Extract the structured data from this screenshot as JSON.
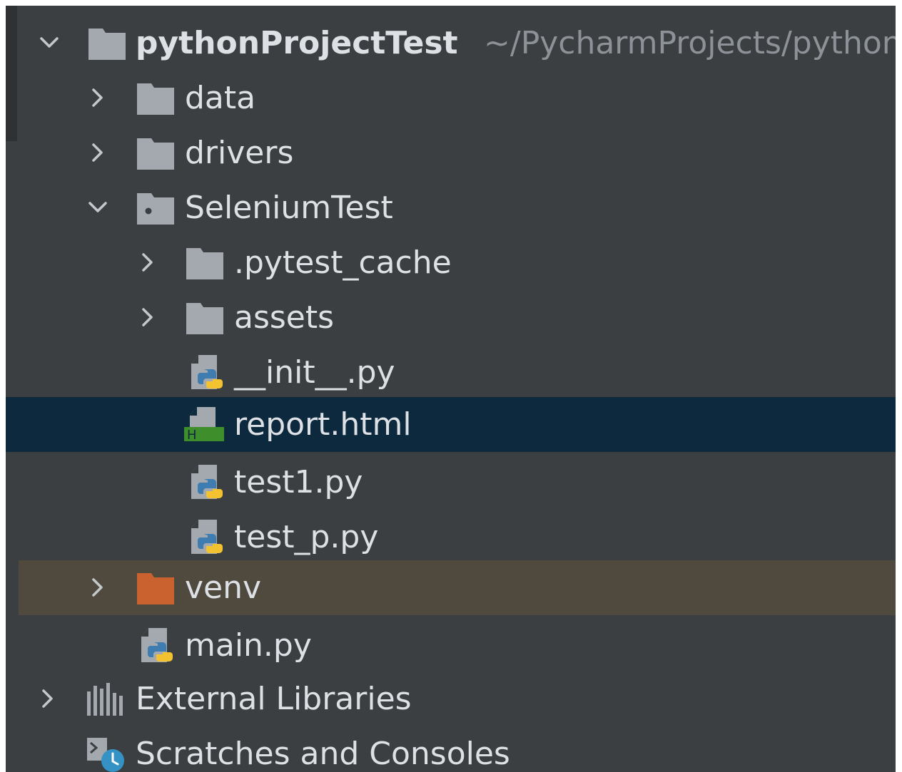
{
  "project_tree": {
    "root": {
      "name": "pythonProjectTest",
      "path": "~/PycharmProjects/pythonProjectTest"
    },
    "items": [
      {
        "name": "data"
      },
      {
        "name": "drivers"
      },
      {
        "name": "SeleniumTest"
      },
      {
        "name": ".pytest_cache"
      },
      {
        "name": "assets"
      },
      {
        "name": "__init__.py"
      },
      {
        "name": "report.html",
        "badge": "H"
      },
      {
        "name": "test1.py"
      },
      {
        "name": "test_p.py"
      },
      {
        "name": "venv"
      },
      {
        "name": "main.py"
      }
    ],
    "external_libraries": "External Libraries",
    "scratches": "Scratches and Consoles"
  },
  "colors": {
    "panel_bg": "#3c3f41",
    "selection_bg": "#0d293e",
    "excluded_bg": "#4f4a3d",
    "folder": "#a3a9ae",
    "excluded_folder": "#c9622f",
    "html_badge": "#3f8e2c",
    "python_blue": "#3f7db1",
    "python_yellow": "#f2c231"
  }
}
